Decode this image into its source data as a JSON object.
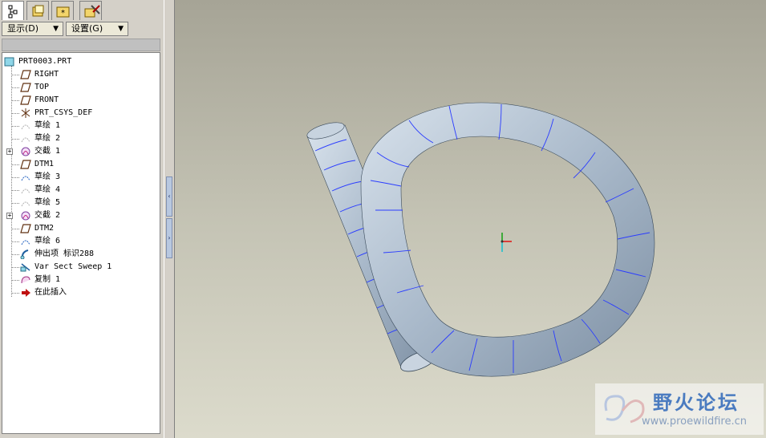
{
  "navigator": {
    "tabs": [
      {
        "icon": "model-tree-icon",
        "active": true
      },
      {
        "icon": "folder-browser-icon",
        "active": false
      },
      {
        "icon": "favorites-folder-icon",
        "active": false
      },
      {
        "icon": "connections-tools-icon",
        "active": false
      }
    ],
    "show_menu_label": "显示(D)",
    "settings_menu_label": "设置(G)"
  },
  "model_tree": {
    "items": [
      {
        "label": "PRT0003.PRT",
        "icon": "part-icon"
      },
      {
        "label": "RIGHT",
        "icon": "datum-plane-icon"
      },
      {
        "label": "TOP",
        "icon": "datum-plane-icon"
      },
      {
        "label": "FRONT",
        "icon": "datum-plane-icon"
      },
      {
        "label": "PRT_CSYS_DEF",
        "icon": "csys-icon"
      },
      {
        "label": "草绘 1",
        "icon": "sketch-hidden-icon"
      },
      {
        "label": "草绘 2",
        "icon": "sketch-hidden-icon"
      },
      {
        "label": "交截 1",
        "icon": "intersect-curve-icon",
        "expandable": true
      },
      {
        "label": "DTM1",
        "icon": "datum-plane-icon"
      },
      {
        "label": "草绘 3",
        "icon": "sketch-icon"
      },
      {
        "label": "草绘 4",
        "icon": "sketch-hidden-icon"
      },
      {
        "label": "草绘 5",
        "icon": "sketch-hidden-icon"
      },
      {
        "label": "交截 2",
        "icon": "intersect-curve-icon",
        "expandable": true
      },
      {
        "label": "DTM2",
        "icon": "datum-plane-icon"
      },
      {
        "label": "草绘 6",
        "icon": "sketch-icon"
      },
      {
        "label": "伸出项 标识288",
        "icon": "sweep-protrusion-icon"
      },
      {
        "label": "Var Sect Sweep 1",
        "icon": "var-sect-sweep-icon"
      },
      {
        "label": "复制 1",
        "icon": "copy-surface-icon"
      },
      {
        "label": "在此插入",
        "icon": "insert-here-arrow-icon"
      }
    ]
  },
  "watermark": {
    "title": "野火论坛",
    "url": "www.proewildfire.cn"
  },
  "colors": {
    "tube": "#aebfcf",
    "tube_edge": "#2a3cff",
    "viewport_top": "#a6a496",
    "viewport_bottom": "#dcdbcc"
  }
}
